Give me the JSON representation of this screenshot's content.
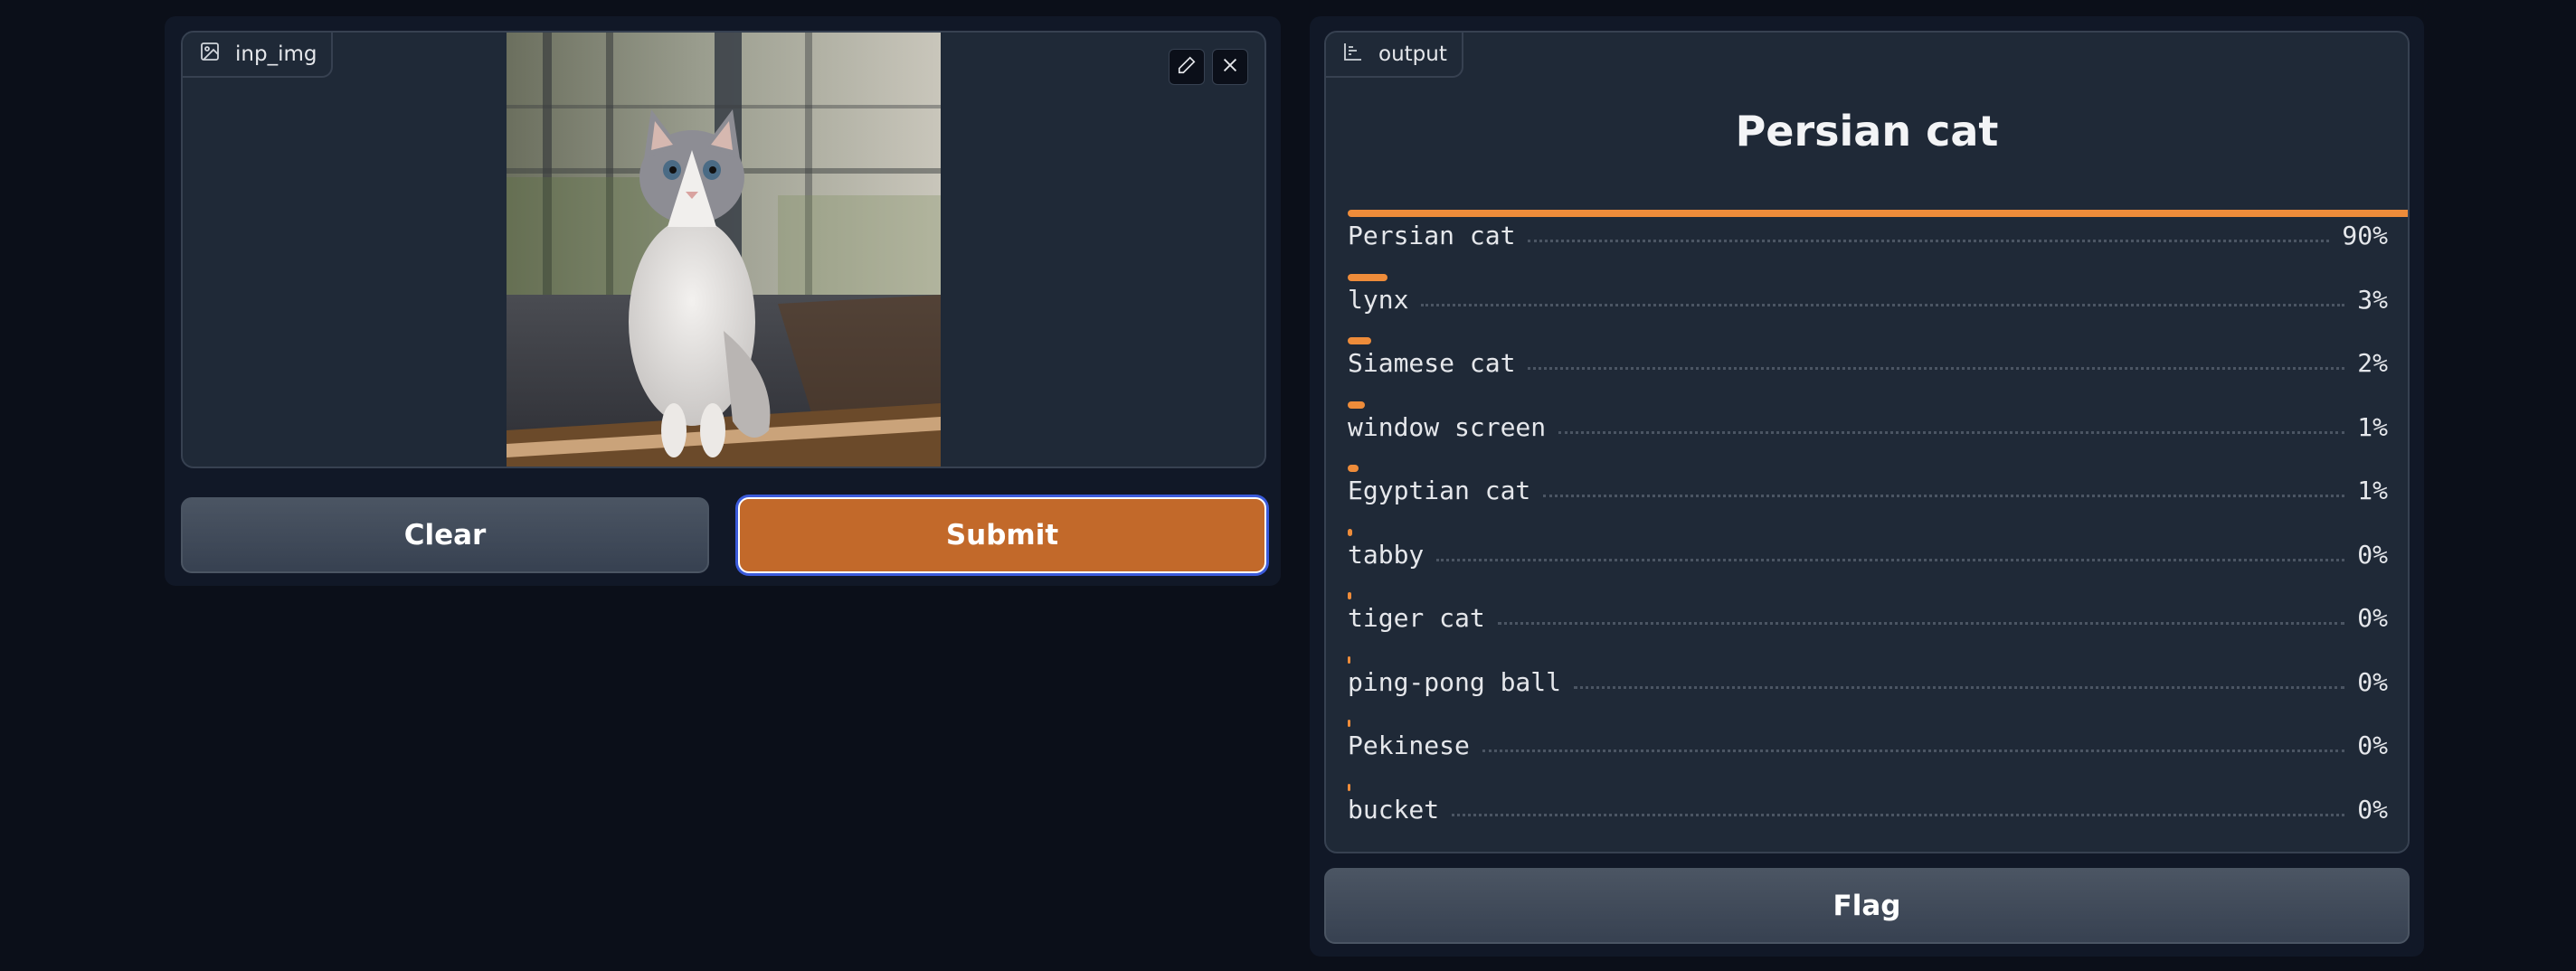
{
  "input": {
    "label": "inp_img",
    "image_icon": "image-icon",
    "edit_icon": "pencil-icon",
    "close_icon": "close-icon"
  },
  "buttons": {
    "clear": "Clear",
    "submit": "Submit",
    "flag": "Flag"
  },
  "output": {
    "label": "output",
    "chart_icon": "bar-chart-icon",
    "top_label": "Persian cat",
    "confidences": [
      {
        "label": "Persian cat",
        "percent": "90%",
        "value": 0.9
      },
      {
        "label": "lynx",
        "percent": "3%",
        "value": 0.033
      },
      {
        "label": "Siamese cat",
        "percent": "2%",
        "value": 0.02
      },
      {
        "label": "window screen",
        "percent": "1%",
        "value": 0.014
      },
      {
        "label": "Egyptian cat",
        "percent": "1%",
        "value": 0.009
      },
      {
        "label": "tabby",
        "percent": "0%",
        "value": 0.004
      },
      {
        "label": "tiger cat",
        "percent": "0%",
        "value": 0.003
      },
      {
        "label": "ping-pong ball",
        "percent": "0%",
        "value": 0.002
      },
      {
        "label": "Pekinese",
        "percent": "0%",
        "value": 0.001
      },
      {
        "label": "bucket",
        "percent": "0%",
        "value": 0.001
      }
    ]
  },
  "colors": {
    "background": "#0b0f19",
    "panel": "#111827",
    "block": "#1f2937",
    "accent": "#c2692a",
    "bar": "#ee8c3a",
    "focus_ring": "#3b5bdb"
  }
}
